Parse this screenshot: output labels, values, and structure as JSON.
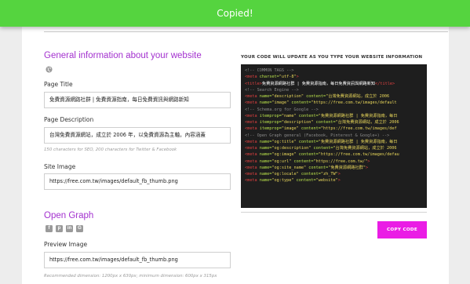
{
  "toast": {
    "message": "Copied!"
  },
  "general": {
    "title": "General information about your website",
    "page_title_label": "Page Title",
    "page_title_value": "免費資源網路社群 | 免費資源指南，每日免費資訊與網路新知",
    "description_label": "Page Description",
    "description_value": "台灣免費資源網站，成立於 2006 年，以免費資源為主軸，內容涵蓋",
    "description_hint": "150 characters for SEO, 200 characters for Twitter & Facebook",
    "site_image_label": "Site Image",
    "site_image_value": "https://free.com.tw/images/default_fb_thumb.png"
  },
  "opengraph": {
    "title": "Open Graph",
    "social_icons": [
      "facebook-icon",
      "pinterest-icon",
      "linkedin-icon",
      "google-plus-icon"
    ],
    "preview_image_label": "Preview Image",
    "preview_image_value": "https://free.com.tw/images/default_fb_thumb.png",
    "preview_hint": "Recommended dimension: 1200px x 630px; minimum dimension: 600px x 315px"
  },
  "code": {
    "header": "YOUR CODE WILL UPDATE AS YOU TYPE YOUR WEBSITE INFORMATION",
    "lines": [
      [
        [
          "cm",
          "<!-- COMMON TAGS -->"
        ]
      ],
      [
        [
          "tg",
          "<meta "
        ],
        [
          "at",
          "charset="
        ],
        [
          "vl",
          "\"utf-8\""
        ],
        [
          "tg",
          ">"
        ]
      ],
      [
        [
          "tg",
          "<title>"
        ],
        [
          "tx",
          "免費資源網路社群 | 免費資源指南，每日免費資訊與網路新知"
        ],
        [
          "tg",
          "</title>"
        ]
      ],
      [
        [
          "cm",
          "<!-- Search Engine -->"
        ]
      ],
      [
        [
          "tg",
          "<meta "
        ],
        [
          "at",
          "name="
        ],
        [
          "vl",
          "\"description\" "
        ],
        [
          "at",
          "content="
        ],
        [
          "vl",
          "\"台灣免費資源網站，成立於 2006"
        ]
      ],
      [
        [
          "tg",
          "<meta "
        ],
        [
          "at",
          "name="
        ],
        [
          "vl",
          "\"image\" "
        ],
        [
          "at",
          "content="
        ],
        [
          "vl",
          "\"https://free.com.tw/images/default"
        ]
      ],
      [
        [
          "cm",
          "<!-- Schema.org for Google -->"
        ]
      ],
      [
        [
          "tg",
          "<meta "
        ],
        [
          "at",
          "itemprop="
        ],
        [
          "vl",
          "\"name\" "
        ],
        [
          "at",
          "content="
        ],
        [
          "vl",
          "\"免費資源網路社群 | 免費資源指南，每日"
        ]
      ],
      [
        [
          "tg",
          "<meta "
        ],
        [
          "at",
          "itemprop="
        ],
        [
          "vl",
          "\"description\" "
        ],
        [
          "at",
          "content="
        ],
        [
          "vl",
          "\"台灣免費資源網站，成立於 2006"
        ]
      ],
      [
        [
          "tg",
          "<meta "
        ],
        [
          "at",
          "itemprop="
        ],
        [
          "vl",
          "\"image\" "
        ],
        [
          "at",
          "content="
        ],
        [
          "vl",
          "\"https://free.com.tw/images/def"
        ]
      ],
      [
        [
          "cm",
          "<!-- Open Graph general (Facebook, Pinterest & Google+) -->"
        ]
      ],
      [
        [
          "tg",
          "<meta "
        ],
        [
          "at",
          "name="
        ],
        [
          "vl",
          "\"og:title\" "
        ],
        [
          "at",
          "content="
        ],
        [
          "vl",
          "\"免費資源網路社群 | 免費資源指南，每日"
        ]
      ],
      [
        [
          "tg",
          "<meta "
        ],
        [
          "at",
          "name="
        ],
        [
          "vl",
          "\"og:description\" "
        ],
        [
          "at",
          "content="
        ],
        [
          "vl",
          "\"台灣免費資源網站，成立於 2006"
        ]
      ],
      [
        [
          "tg",
          "<meta "
        ],
        [
          "at",
          "name="
        ],
        [
          "vl",
          "\"og:image\" "
        ],
        [
          "at",
          "content="
        ],
        [
          "vl",
          "\"https://free.com.tw/images/defau"
        ]
      ],
      [
        [
          "tg",
          "<meta "
        ],
        [
          "at",
          "name="
        ],
        [
          "vl",
          "\"og:url\" "
        ],
        [
          "at",
          "content="
        ],
        [
          "vl",
          "\"https://free.com.tw/\""
        ],
        [
          "tg",
          ">"
        ]
      ],
      [
        [
          "tg",
          "<meta "
        ],
        [
          "at",
          "name="
        ],
        [
          "vl",
          "\"og:site_name\" "
        ],
        [
          "at",
          "content="
        ],
        [
          "vl",
          "\"免費資源網路社群\""
        ],
        [
          "tg",
          ">"
        ]
      ],
      [
        [
          "tg",
          "<meta "
        ],
        [
          "at",
          "name="
        ],
        [
          "vl",
          "\"og:locale\" "
        ],
        [
          "at",
          "content="
        ],
        [
          "vl",
          "\"zh_TW\""
        ],
        [
          "tg",
          ">"
        ]
      ],
      [
        [
          "tg",
          "<meta "
        ],
        [
          "at",
          "name="
        ],
        [
          "vl",
          "\"og:type\" "
        ],
        [
          "at",
          "content="
        ],
        [
          "vl",
          "\"website\""
        ],
        [
          "tg",
          ">"
        ]
      ]
    ],
    "copy_button": "COPY CODE"
  }
}
